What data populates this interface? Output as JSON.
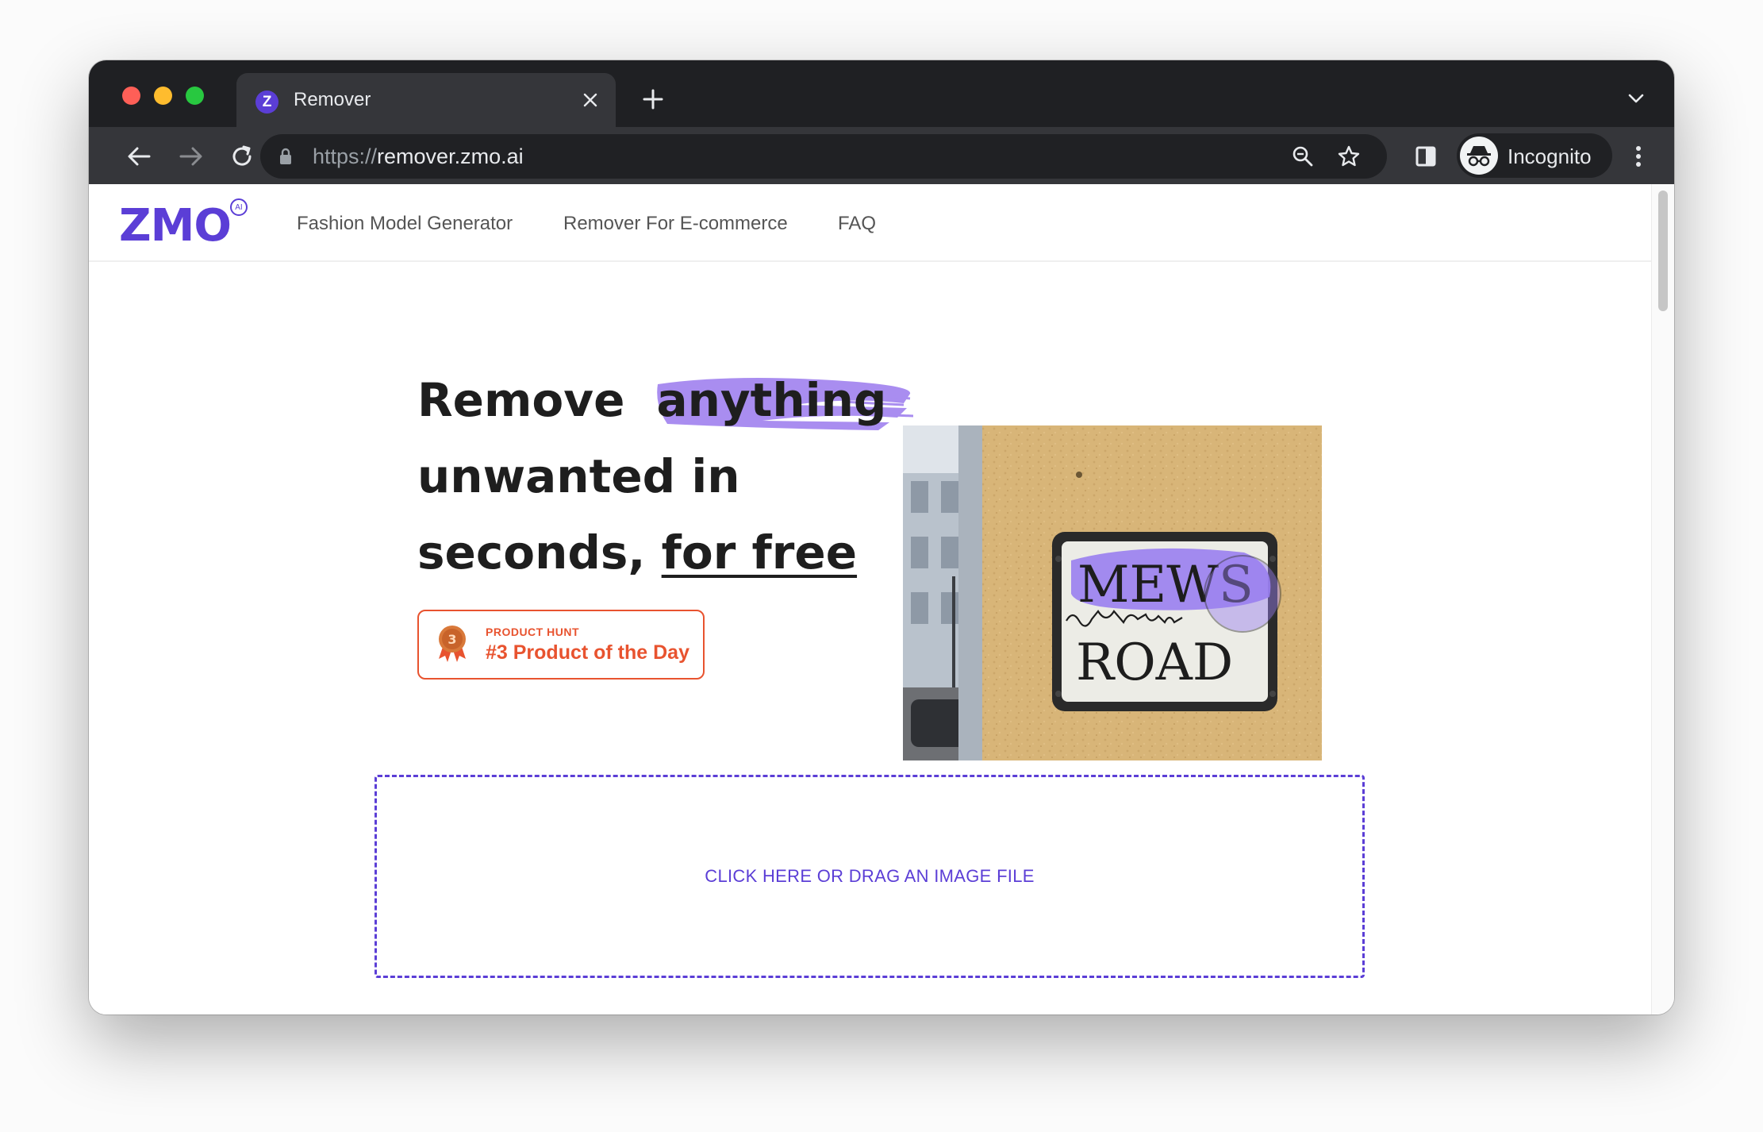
{
  "browser": {
    "tab_title": "Remover",
    "tab_favicon_letter": "Z",
    "url_scheme": "https://",
    "url_host": "remover.zmo.ai",
    "profile_label": "Incognito"
  },
  "site": {
    "logo_text": "ZMO",
    "logo_badge": "AI",
    "nav": [
      {
        "label": "Fashion Model Generator"
      },
      {
        "label": "Remover For E-commerce"
      },
      {
        "label": "FAQ"
      }
    ]
  },
  "hero": {
    "title_part1": "Remove",
    "title_highlight": "anything",
    "title_part2": "unwanted in",
    "title_part3": "seconds,",
    "title_underlined": "for free",
    "highlight_color": "#a98df0"
  },
  "badge": {
    "medal_number": "3",
    "kicker": "PRODUCT HUNT",
    "rank_text": "#3 Product of the Day",
    "color": "#e8532f"
  },
  "demo": {
    "sign_line1": "MEWS",
    "sign_line2": "ROAD"
  },
  "upload": {
    "cta": "CLICK HERE OR DRAG AN IMAGE FILE"
  },
  "theme": {
    "accent": "#5b3ed6",
    "chrome_dark": "#1f2023",
    "chrome_toolbar": "#35363a"
  }
}
